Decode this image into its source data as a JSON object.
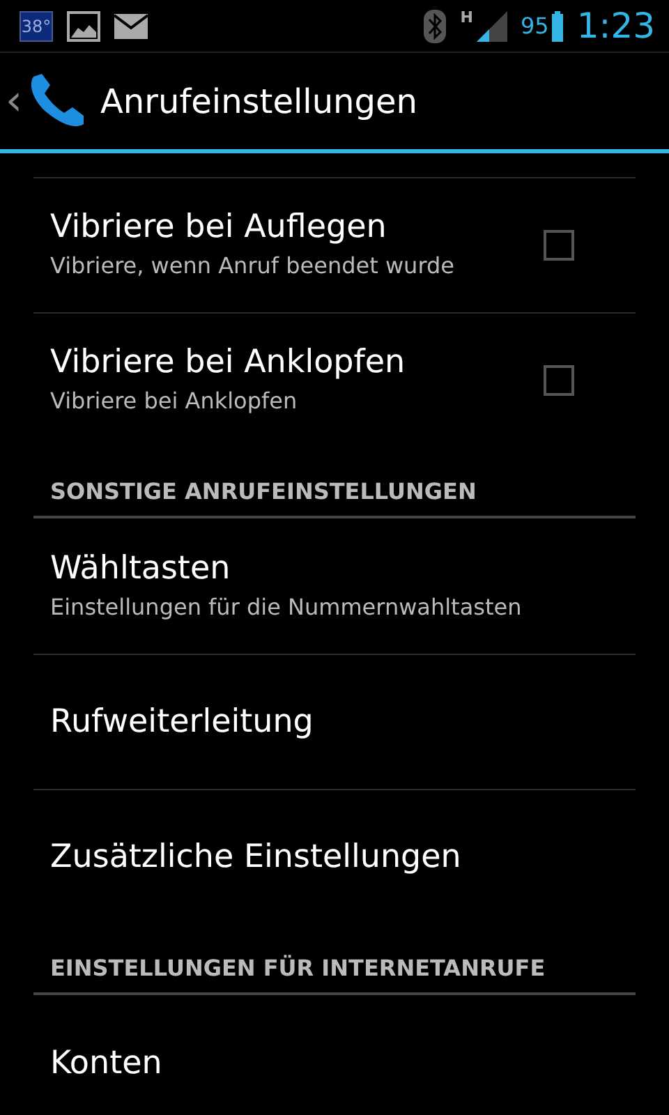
{
  "status_bar": {
    "weather": "38°",
    "network": "H",
    "battery": "95",
    "time": "1:23"
  },
  "action_bar": {
    "back": "‹",
    "title": "Anrufeinstellungen"
  },
  "items": [
    {
      "kind": "checkbox",
      "title": "Vibriere bei Auflegen",
      "summary": "Vibriere, wenn Anruf beendet wurde",
      "checked": false
    },
    {
      "kind": "checkbox",
      "title": "Vibriere bei Anklopfen",
      "summary": "Vibriere bei Anklopfen",
      "checked": false
    },
    {
      "kind": "header",
      "title": "SONSTIGE ANRUFEINSTELLUNGEN"
    },
    {
      "kind": "plain",
      "title": "Wähltasten",
      "summary": "Einstellungen für die Nummernwahltasten"
    },
    {
      "kind": "plain",
      "title": "Rufweiterleitung"
    },
    {
      "kind": "plain",
      "title": "Zusätzliche Einstellungen"
    },
    {
      "kind": "header",
      "title": "EINSTELLUNGEN FÜR INTERNETANRUFE"
    },
    {
      "kind": "plain",
      "title": "Konten"
    }
  ]
}
